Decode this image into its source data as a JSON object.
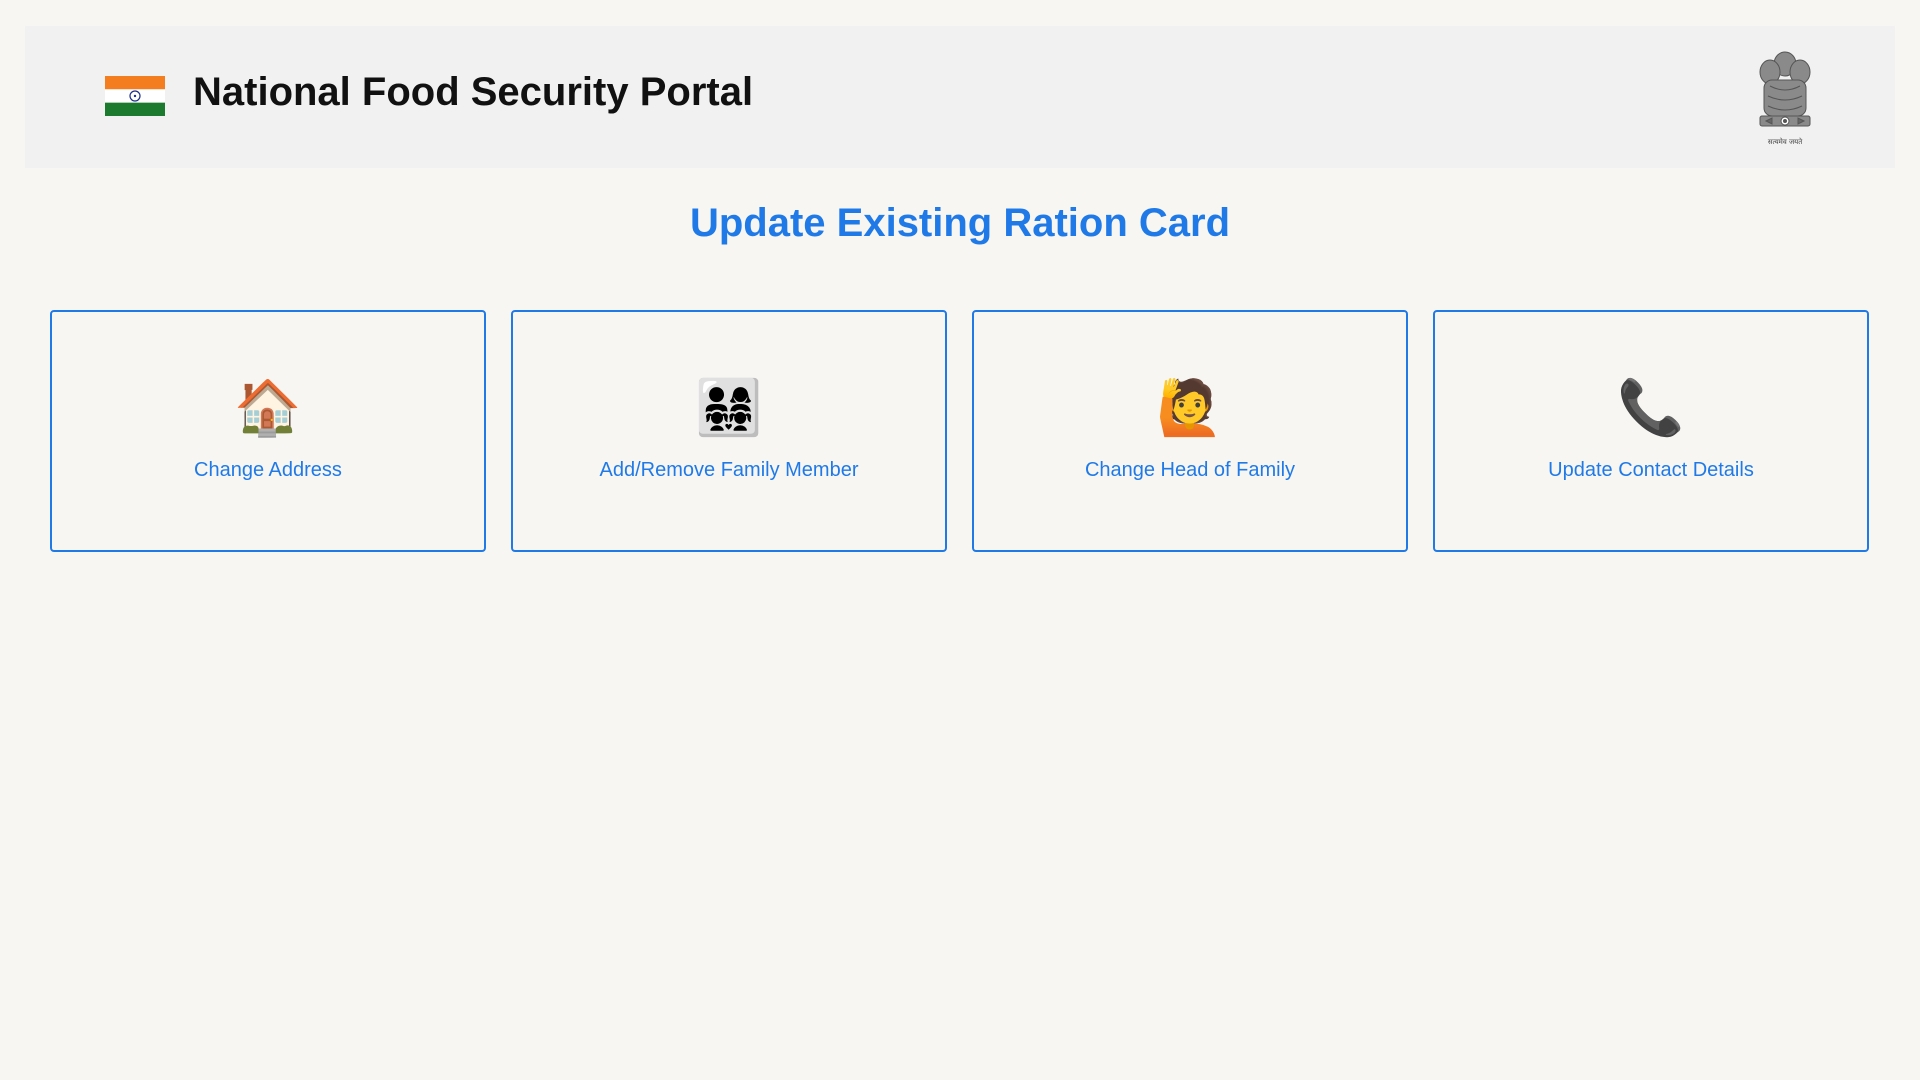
{
  "header": {
    "site_title": "National Food Security Portal",
    "emblem_motto": "सत्यमेव जयते",
    "flag_colors": {
      "saffron": "#f47d20",
      "white": "#ffffff",
      "green": "#1c7a2e",
      "chakra": "#1f2e8a"
    }
  },
  "page_title": "Update Existing Ration Card",
  "accent_color": "#1f7ae8",
  "cards": [
    {
      "label": "Change Address",
      "icon": "house-icon",
      "glyph": "🏠"
    },
    {
      "label": "Add/Remove Family Member",
      "icon": "family-icon",
      "glyph": "👨‍👩‍👧‍👧"
    },
    {
      "label": "Change Head of Family",
      "icon": "raising-hand-person-icon",
      "glyph": "🙋"
    },
    {
      "label": "Update Contact Details",
      "icon": "telephone-receiver-icon",
      "glyph": "📞"
    }
  ]
}
